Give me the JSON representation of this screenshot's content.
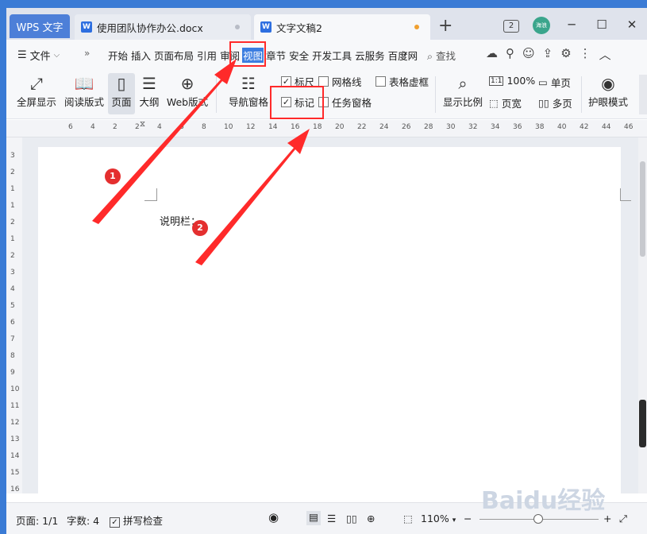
{
  "tabs": {
    "app_label": "WPS 文字",
    "doc1": "使用团队协作办公.docx",
    "doc2": "文字文稿2",
    "new_tab": "+"
  },
  "titlebar": {
    "window_count": "2",
    "avatar_text": "海浪"
  },
  "menu": {
    "file_label": "文件",
    "items": [
      "开始",
      "插入",
      "页面布局",
      "引用",
      "审阅",
      "视图",
      "章节",
      "安全",
      "开发工具",
      "云服务",
      "百度网"
    ],
    "search_label": "查找"
  },
  "ribbon": {
    "fullscreen": "全屏显示",
    "reading": "阅读版式",
    "page": "页面",
    "outline": "大纲",
    "web": "Web版式",
    "nav_pane": "导航窗格",
    "ruler": "标尺",
    "gridlines": "网格线",
    "table_gridlines": "表格虚框",
    "marks": "标记",
    "task_pane": "任务窗格",
    "zoom_ratio": "显示比例",
    "zoom_100": "100%",
    "zoom_100_icon": "1:1",
    "single_page": "单页",
    "page_width": "页宽",
    "multi_page": "多页",
    "eye_mode": "护眼模式"
  },
  "checkboxes": {
    "ruler": true,
    "gridlines": false,
    "table_gridlines": false,
    "marks": true,
    "task_pane": false
  },
  "ruler_h": [
    "6",
    "4",
    "2",
    "2",
    "4",
    "6",
    "8",
    "10",
    "12",
    "14",
    "16",
    "18",
    "20",
    "22",
    "24",
    "26",
    "28",
    "30",
    "32",
    "34",
    "36",
    "38",
    "40",
    "42",
    "44",
    "46"
  ],
  "ruler_v": [
    "3",
    "2",
    "1",
    "1",
    "2",
    "1",
    "2",
    "3",
    "4",
    "5",
    "6",
    "7",
    "8",
    "9",
    "10",
    "11",
    "12",
    "13",
    "14",
    "15",
    "16"
  ],
  "document": {
    "text": "说明栏："
  },
  "status": {
    "page": "页面: 1/1",
    "words": "字数: 4",
    "spell": "拼写检查",
    "zoom": "110%"
  },
  "annotations": {
    "step1": "1",
    "step2": "2",
    "watermark": "Baidu经验"
  }
}
